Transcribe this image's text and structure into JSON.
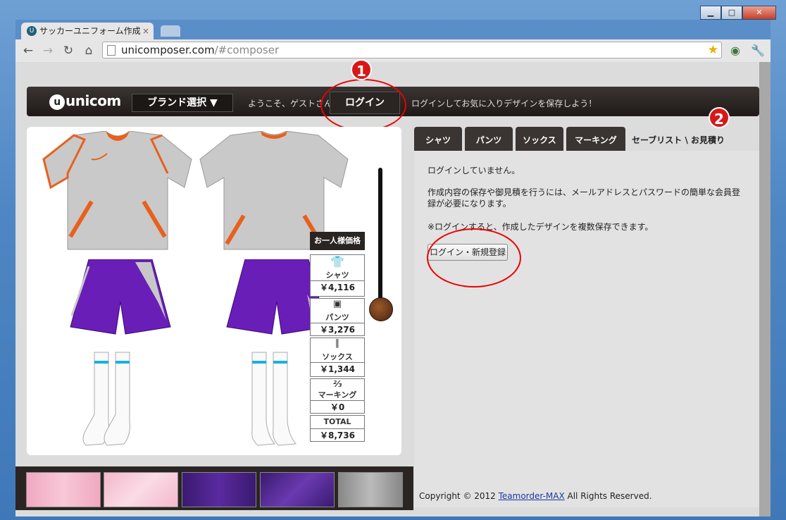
{
  "window": {
    "tab_title": "サッカーユニフォーム作成",
    "tab_close": "×",
    "controls": {
      "minimize": "▁",
      "maximize": "□",
      "close": "✕"
    }
  },
  "toolbar": {
    "url_host": "unicomposer.com",
    "url_path": "/#composer"
  },
  "site": {
    "logo": "unicom",
    "brand_select": "ブランド選択 ▼",
    "welcome": "ようこそ、ゲストさん",
    "login": "ログイン",
    "promo": "ログインしてお気に入りデザインを保存しよう！"
  },
  "annotations": {
    "badge1": "1",
    "badge2": "2"
  },
  "price": {
    "header": "お一人様価格",
    "items": [
      {
        "name": "シャツ",
        "price": "￥4,116"
      },
      {
        "name": "パンツ",
        "price": "￥3,276"
      },
      {
        "name": "ソックス",
        "price": "￥1,344"
      },
      {
        "name": "マーキング",
        "price": "￥0"
      },
      {
        "name": "TOTAL",
        "price": "￥8,736"
      }
    ]
  },
  "tabs": [
    "シャツ",
    "パンツ",
    "ソックス",
    "マーキング",
    "セーブリスト \\ お見積り"
  ],
  "panel": {
    "line1": "ログインしていません。",
    "line2a": "作成内容の保存や御見積を行うには、メールアドレスとパスワードの簡単な会員登",
    "line2b": "録が必要になります。",
    "line3": "※ログインすると、作成したデザインを複数保存できます。",
    "button": "ログイン・新規登録",
    "copyright_prefix": "Copyright © 2012 ",
    "copyright_link": "Teamorder-MAX",
    "copyright_suffix": " All Rights Reserved."
  },
  "colors": {
    "accent": "#e00000",
    "shirt": "#c8c8c8",
    "trim": "#e8601c",
    "shorts": "#6a1eb8"
  }
}
